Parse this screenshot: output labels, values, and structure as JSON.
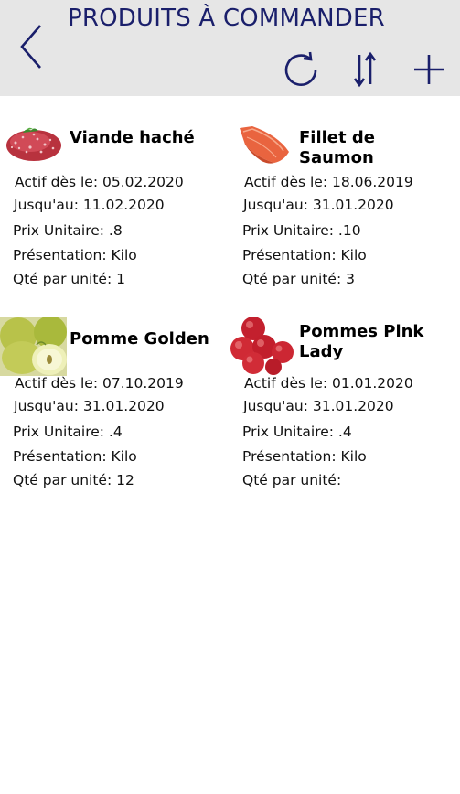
{
  "header": {
    "title": "PRODUITS À COMMANDER",
    "accent_color": "#1a1f6b",
    "background": "#e6e6e6",
    "icons": [
      "chevron-left-icon",
      "refresh-icon",
      "sort-icon",
      "plus-icon"
    ]
  },
  "labels": {
    "actif": "Actif dès le:",
    "jusqu": "Jusqu'au:",
    "prix": "Prix Unitaire:",
    "presentation": "Présentation:",
    "qte": "Qté par unité:"
  },
  "products": [
    {
      "name": "Viande haché",
      "image": "ground-meat-image",
      "actif": "Actif dès le: 05.02.2020",
      "jusqu": "Jusqu'au: 11.02.2020",
      "prix": "Prix Unitaire: .8",
      "presentation": "Présentation: Kilo",
      "qte": "Qté par unité: 1"
    },
    {
      "name": "Fillet de Saumon",
      "image": "salmon-fillet-image",
      "actif": "Actif dès le: 18.06.2019",
      "jusqu": "Jusqu'au: 31.01.2020",
      "prix": "Prix Unitaire: .10",
      "presentation": "Présentation: Kilo",
      "qte": "Qté par unité: 3"
    },
    {
      "name": "Pomme Golden",
      "image": "golden-apple-image",
      "actif": "Actif dès le: 07.10.2019",
      "jusqu": "Jusqu'au: 31.01.2020",
      "prix": "Prix Unitaire: .4",
      "presentation": "Présentation: Kilo",
      "qte": "Qté par unité: 12"
    },
    {
      "name": "Pommes Pink Lady",
      "image": "pink-lady-apples-image",
      "actif": "Actif dès le: 01.01.2020",
      "jusqu": "Jusqu'au: 31.01.2020",
      "prix": "Prix Unitaire: .4",
      "presentation": "Présentation: Kilo",
      "qte": "Qté par unité:"
    }
  ]
}
